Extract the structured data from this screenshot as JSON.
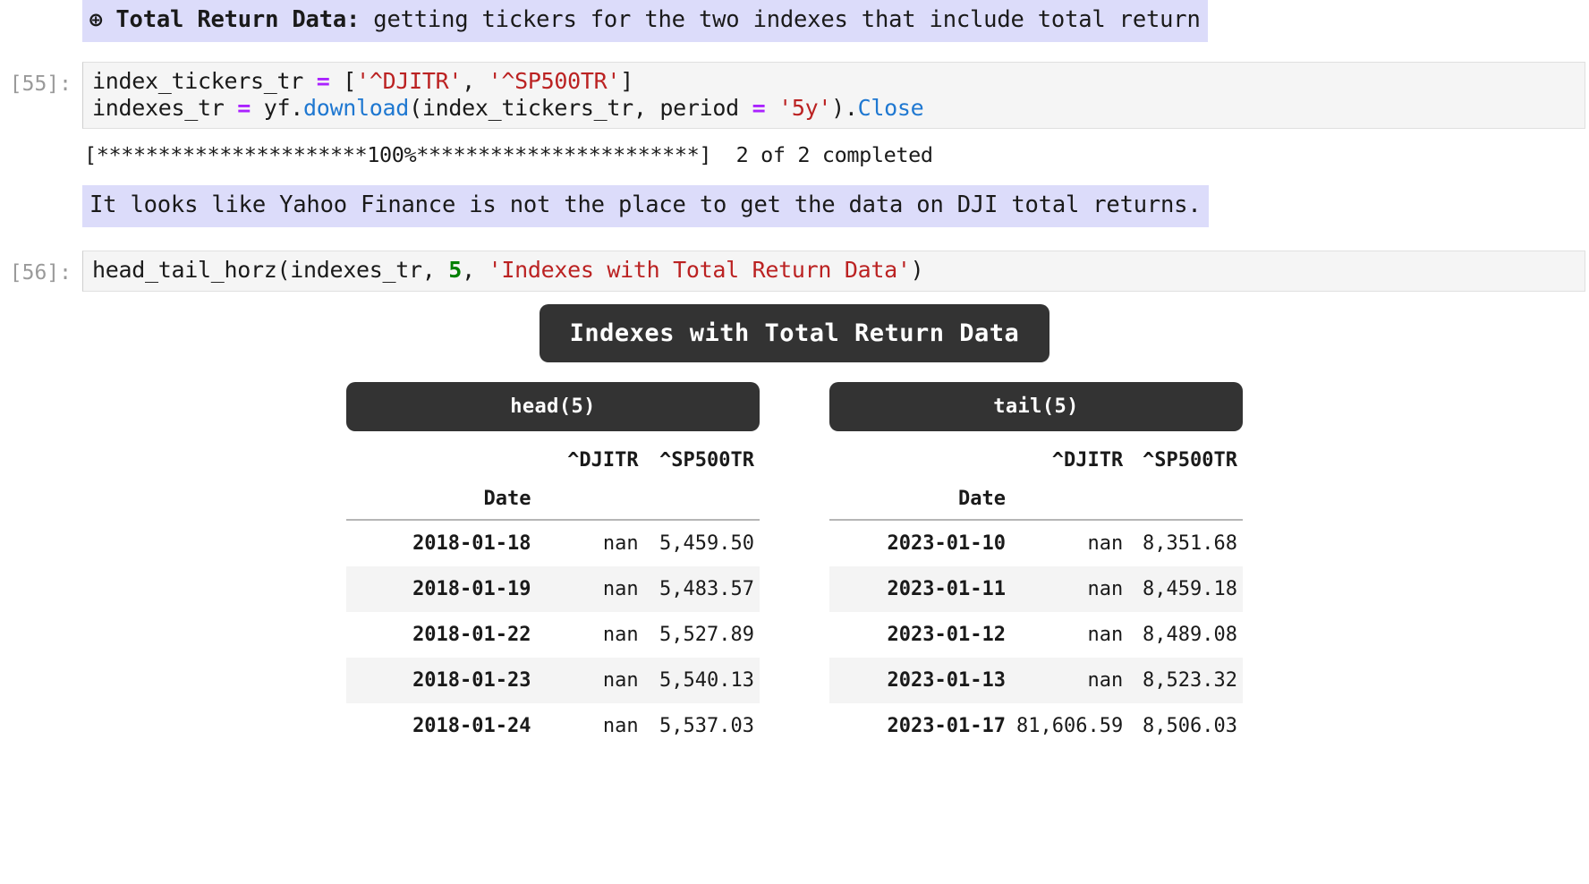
{
  "markdown_cells": [
    {
      "icon": "circled-plus-icon",
      "icon_glyph": "⊕",
      "bold_prefix": "Total Return Data:",
      "rest": " getting tickers for the two indexes that include total return",
      "highlight_color": "#dcdcfa"
    },
    {
      "text": "It looks like Yahoo Finance is not the place to get the data on DJI total returns.",
      "highlight_color": "#dcdcfa"
    }
  ],
  "cells": [
    {
      "prompt": "[55]:",
      "code_lines": [
        [
          {
            "t": "index_tickers_tr ",
            "k": "plain"
          },
          {
            "t": "=",
            "k": "op"
          },
          {
            "t": " [",
            "k": "plain"
          },
          {
            "t": "'^DJITR'",
            "k": "str"
          },
          {
            "t": ", ",
            "k": "plain"
          },
          {
            "t": "'^SP500TR'",
            "k": "str"
          },
          {
            "t": "]",
            "k": "plain"
          }
        ],
        [
          {
            "t": "indexes_tr ",
            "k": "plain"
          },
          {
            "t": "=",
            "k": "op"
          },
          {
            "t": " yf.",
            "k": "plain"
          },
          {
            "t": "download",
            "k": "fn"
          },
          {
            "t": "(index_tickers_tr, period ",
            "k": "plain"
          },
          {
            "t": "=",
            "k": "op"
          },
          {
            "t": " ",
            "k": "plain"
          },
          {
            "t": "'5y'",
            "k": "str"
          },
          {
            "t": ").",
            "k": "plain"
          },
          {
            "t": "Close",
            "k": "fn"
          }
        ]
      ],
      "stdout": "[**********************100%***********************]  2 of 2 completed"
    },
    {
      "prompt": "[56]:",
      "code_lines": [
        [
          {
            "t": "head_tail_horz(indexes_tr, ",
            "k": "plain"
          },
          {
            "t": "5",
            "k": "num"
          },
          {
            "t": ", ",
            "k": "plain"
          },
          {
            "t": "'Indexes with Total Return Data'",
            "k": "str"
          },
          {
            "t": ")",
            "k": "plain"
          }
        ]
      ]
    }
  ],
  "dataframe_output": {
    "title": "Indexes with Total Return Data",
    "tables": [
      {
        "subtitle": "head(5)",
        "index_name": "Date",
        "columns": [
          "^DJITR",
          "^SP500TR"
        ],
        "rows": [
          {
            "index": "2018-01-18",
            "values": [
              "nan",
              "5,459.50"
            ]
          },
          {
            "index": "2018-01-19",
            "values": [
              "nan",
              "5,483.57"
            ]
          },
          {
            "index": "2018-01-22",
            "values": [
              "nan",
              "5,527.89"
            ]
          },
          {
            "index": "2018-01-23",
            "values": [
              "nan",
              "5,540.13"
            ]
          },
          {
            "index": "2018-01-24",
            "values": [
              "nan",
              "5,537.03"
            ]
          }
        ]
      },
      {
        "subtitle": "tail(5)",
        "index_name": "Date",
        "columns": [
          "^DJITR",
          "^SP500TR"
        ],
        "rows": [
          {
            "index": "2023-01-10",
            "values": [
              "nan",
              "8,351.68"
            ]
          },
          {
            "index": "2023-01-11",
            "values": [
              "nan",
              "8,459.18"
            ]
          },
          {
            "index": "2023-01-12",
            "values": [
              "nan",
              "8,489.08"
            ]
          },
          {
            "index": "2023-01-13",
            "values": [
              "nan",
              "8,523.32"
            ]
          },
          {
            "index": "2023-01-17",
            "values": [
              "81,606.59",
              "8,506.03"
            ]
          }
        ]
      }
    ]
  },
  "colors": {
    "markdown_highlight": "#dcdcfa",
    "header_dark": "#333333",
    "code_background": "#f5f5f5",
    "string_red": "#bb2222",
    "operator_purple": "#aa22ff",
    "function_blue": "#1f78d1",
    "number_green": "#008000",
    "prompt_gray": "#9a9a9a"
  }
}
